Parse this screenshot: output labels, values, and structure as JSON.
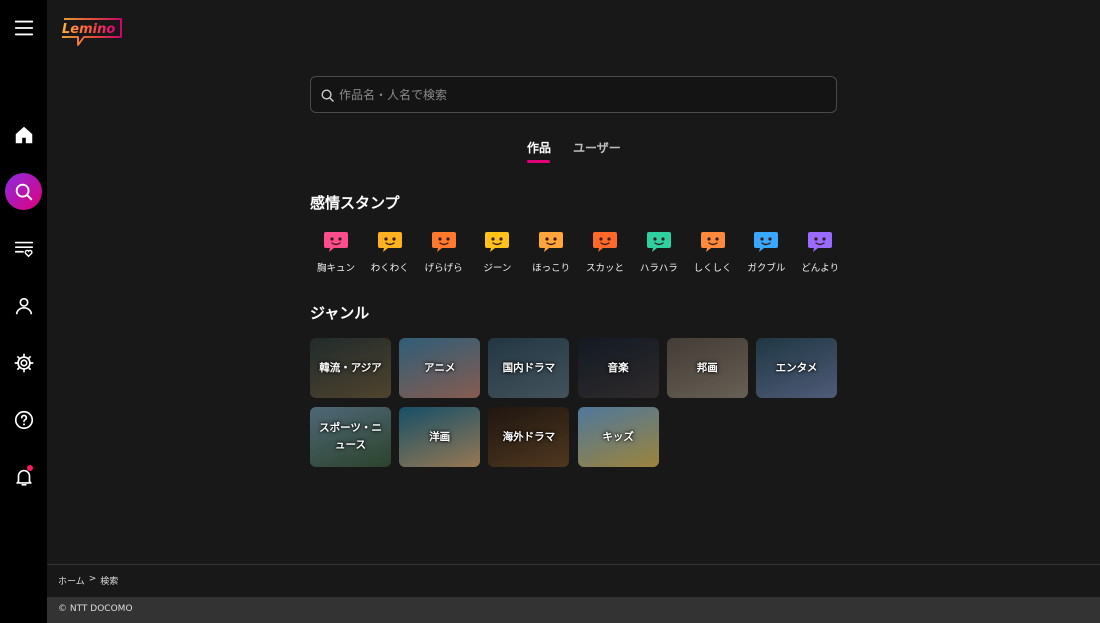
{
  "logo": {
    "text": "Lemino"
  },
  "sidebar": {
    "items": [
      {
        "name": "home"
      },
      {
        "name": "search"
      },
      {
        "name": "list"
      },
      {
        "name": "account"
      },
      {
        "name": "settings"
      },
      {
        "name": "help"
      },
      {
        "name": "notifications"
      }
    ]
  },
  "search": {
    "placeholder": "作品名・人名で検索",
    "value": ""
  },
  "tabs": [
    {
      "label": "作品"
    },
    {
      "label": "ユーザー"
    }
  ],
  "stamps": {
    "title": "感情スタンプ",
    "items": [
      {
        "label": "胸キュン",
        "color": "#ff4d8d"
      },
      {
        "label": "わくわく",
        "color": "#ffb21f"
      },
      {
        "label": "げらげら",
        "color": "#ff7a2f"
      },
      {
        "label": "ジーン",
        "color": "#ffc21a"
      },
      {
        "label": "ほっこり",
        "color": "#ffa53a"
      },
      {
        "label": "スカッと",
        "color": "#ff6a2a"
      },
      {
        "label": "ハラハラ",
        "color": "#2fd0a0"
      },
      {
        "label": "しくしく",
        "color": "#ff8a3d"
      },
      {
        "label": "ガクブル",
        "color": "#3aa8ff"
      },
      {
        "label": "どんより",
        "color": "#9a6bff"
      }
    ]
  },
  "genres": {
    "title": "ジャンル",
    "items": [
      {
        "label": "韓流・アジア",
        "c1": "#2d3a3a",
        "c2": "#6a5a3e"
      },
      {
        "label": "アニメ",
        "c1": "#3f7ea0",
        "c2": "#b37a6b"
      },
      {
        "label": "国内ドラマ",
        "c1": "#2e4a5a",
        "c2": "#5a6e7a"
      },
      {
        "label": "音楽",
        "c1": "#1a2230",
        "c2": "#3e3a3a"
      },
      {
        "label": "邦画",
        "c1": "#5a5048",
        "c2": "#8a8070"
      },
      {
        "label": "エンタメ",
        "c1": "#2a4a5a",
        "c2": "#6a7aa0"
      },
      {
        "label": "スポーツ・ニュース",
        "c1": "#6a8aa0",
        "c2": "#3a5a3a"
      },
      {
        "label": "洋画",
        "c1": "#1e6a8a",
        "c2": "#c9a070"
      },
      {
        "label": "海外ドラマ",
        "c1": "#2a1e16",
        "c2": "#6a4a2a"
      },
      {
        "label": "キッズ",
        "c1": "#6aa0d0",
        "c2": "#d0b050"
      }
    ]
  },
  "breadcrumb": {
    "home": "ホーム",
    "sep": ">",
    "current": "検索"
  },
  "footer": {
    "copyright": "© NTT DOCOMO"
  }
}
